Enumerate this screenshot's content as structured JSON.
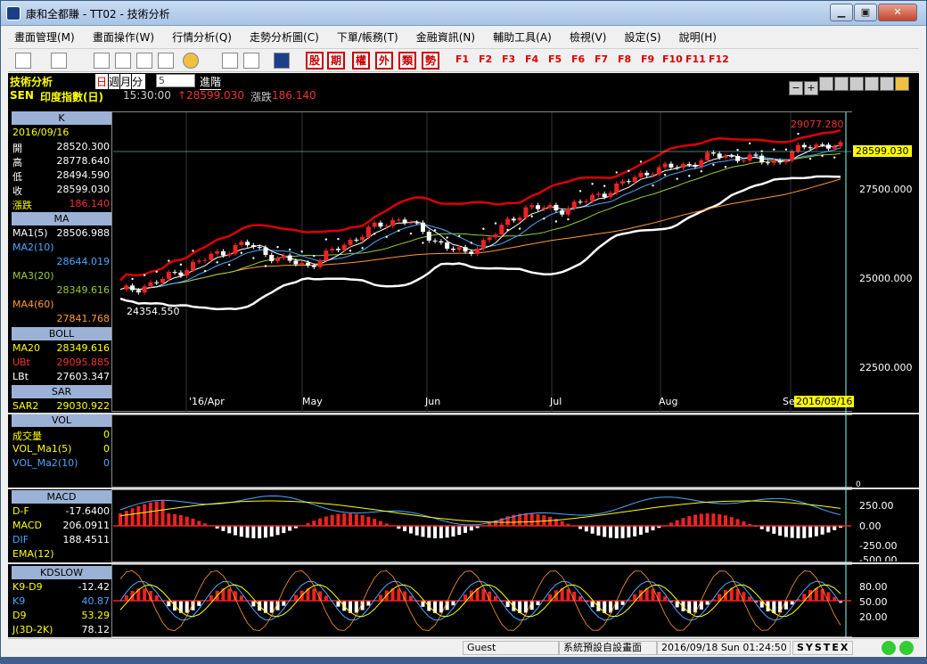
{
  "window": {
    "title": "康和全都賺 - TT02 - 技術分析"
  },
  "menu": [
    "畫面管理(M)",
    "畫面操作(W)",
    "行情分析(Q)",
    "走勢分析圖(C)",
    "下單/帳務(T)",
    "金融資訊(N)",
    "輔助工具(A)",
    "檢視(V)",
    "設定(S)",
    "說明(H)"
  ],
  "toolbar": {
    "char_buttons": [
      "股",
      "期",
      "權",
      "外",
      "類",
      "勢"
    ],
    "fkeys": [
      "F1",
      "F2",
      "F3",
      "F4",
      "F5",
      "F6",
      "F7",
      "F8",
      "F9",
      "F10",
      "F11",
      "F12"
    ]
  },
  "info": {
    "panel_title": "技術分析",
    "period_day": "日",
    "period_week": "週",
    "period_month": "月",
    "period_min": "分",
    "period_value": "5",
    "advanced": "進階",
    "symbol": "SEN",
    "name": "印度指數(日)",
    "time": "15:30:00",
    "price": "↑28599.030",
    "change_label": "漲跌",
    "change": "186.140"
  },
  "left_panel": {
    "k_header": "K",
    "date": "2016/09/16",
    "ohlc": [
      {
        "label": "開",
        "value": "28520.300"
      },
      {
        "label": "高",
        "value": "28778.640"
      },
      {
        "label": "低",
        "value": "28494.590"
      },
      {
        "label": "收",
        "value": "28599.030"
      },
      {
        "label": "漲跌",
        "value": "186.140"
      }
    ],
    "ma_header": "MA",
    "ma": [
      {
        "label": "MA1(5)",
        "value": "28506.988"
      },
      {
        "label": "MA2(10)",
        "value": "28644.019"
      },
      {
        "label": "MA3(20)",
        "value": "28349.616"
      },
      {
        "label": "MA4(60)",
        "value": "27841.768"
      }
    ],
    "boll_header": "BOLL",
    "boll": [
      {
        "label": "MA20",
        "value": "28349.616"
      },
      {
        "label": "UBt",
        "value": "29095.885"
      },
      {
        "label": "LBt",
        "value": "27603.347"
      }
    ],
    "sar_header": "SAR",
    "sar": {
      "label": "SAR2",
      "value": "29030.922"
    },
    "vol_header": "VOL",
    "vol": [
      {
        "label": "成交量",
        "value": "0"
      },
      {
        "label": "VOL_Ma1(5)",
        "value": "0"
      },
      {
        "label": "VOL_Ma2(10)",
        "value": "0"
      }
    ],
    "macd_header": "MACD",
    "macd": [
      {
        "label": "D-F",
        "value": "-17.6400"
      },
      {
        "label": "MACD",
        "value": "206.0911"
      },
      {
        "label": "DIF",
        "value": "188.4511"
      },
      {
        "label": "EMA(12)",
        "value": ""
      }
    ],
    "kd_header": "KDSLOW",
    "kd": [
      {
        "label": "K9-D9",
        "value": "-12.42"
      },
      {
        "label": "K9",
        "value": "40.87"
      },
      {
        "label": "D9",
        "value": "53.29"
      },
      {
        "label": "J(3D-2K)",
        "value": "78.12"
      }
    ]
  },
  "price_axis": [
    "27500.000",
    "25000.000",
    "22500.000"
  ],
  "current_price_tag": "28599.030",
  "high_label": "29077.280",
  "low_label": "24354.550",
  "date_cursor": "2016/09/16",
  "months": [
    "'16/Apr",
    "May",
    "Jun",
    "Jul",
    "Aug",
    "Se"
  ],
  "macd_axis": [
    "250.00",
    "0.00",
    "-250.00",
    "-500.00"
  ],
  "kd_axis": [
    "80.00",
    "50.00",
    "20.00"
  ],
  "vol_axis": [
    "0"
  ],
  "status": {
    "user": "Guest",
    "layout": "系統預設自設畫面",
    "datetime": "2016/09/18 Sun 01:24:50",
    "brand": "SYSTEX"
  },
  "chart_data": {
    "type": "candlestick",
    "title": "",
    "ylim": [
      21500,
      29500
    ],
    "x": [
      "'16/Apr",
      "May",
      "Jun",
      "Jul",
      "Aug",
      "Se"
    ],
    "series": [
      {
        "name": "close",
        "values": [
          24700,
          24900,
          25300,
          25700,
          26000,
          25600,
          25400,
          25900,
          26400,
          26700,
          26100,
          25700,
          26300,
          27000,
          26900,
          27200,
          27600,
          28000,
          28100,
          28400,
          28300,
          28200,
          28700,
          28599
        ]
      }
    ]
  }
}
